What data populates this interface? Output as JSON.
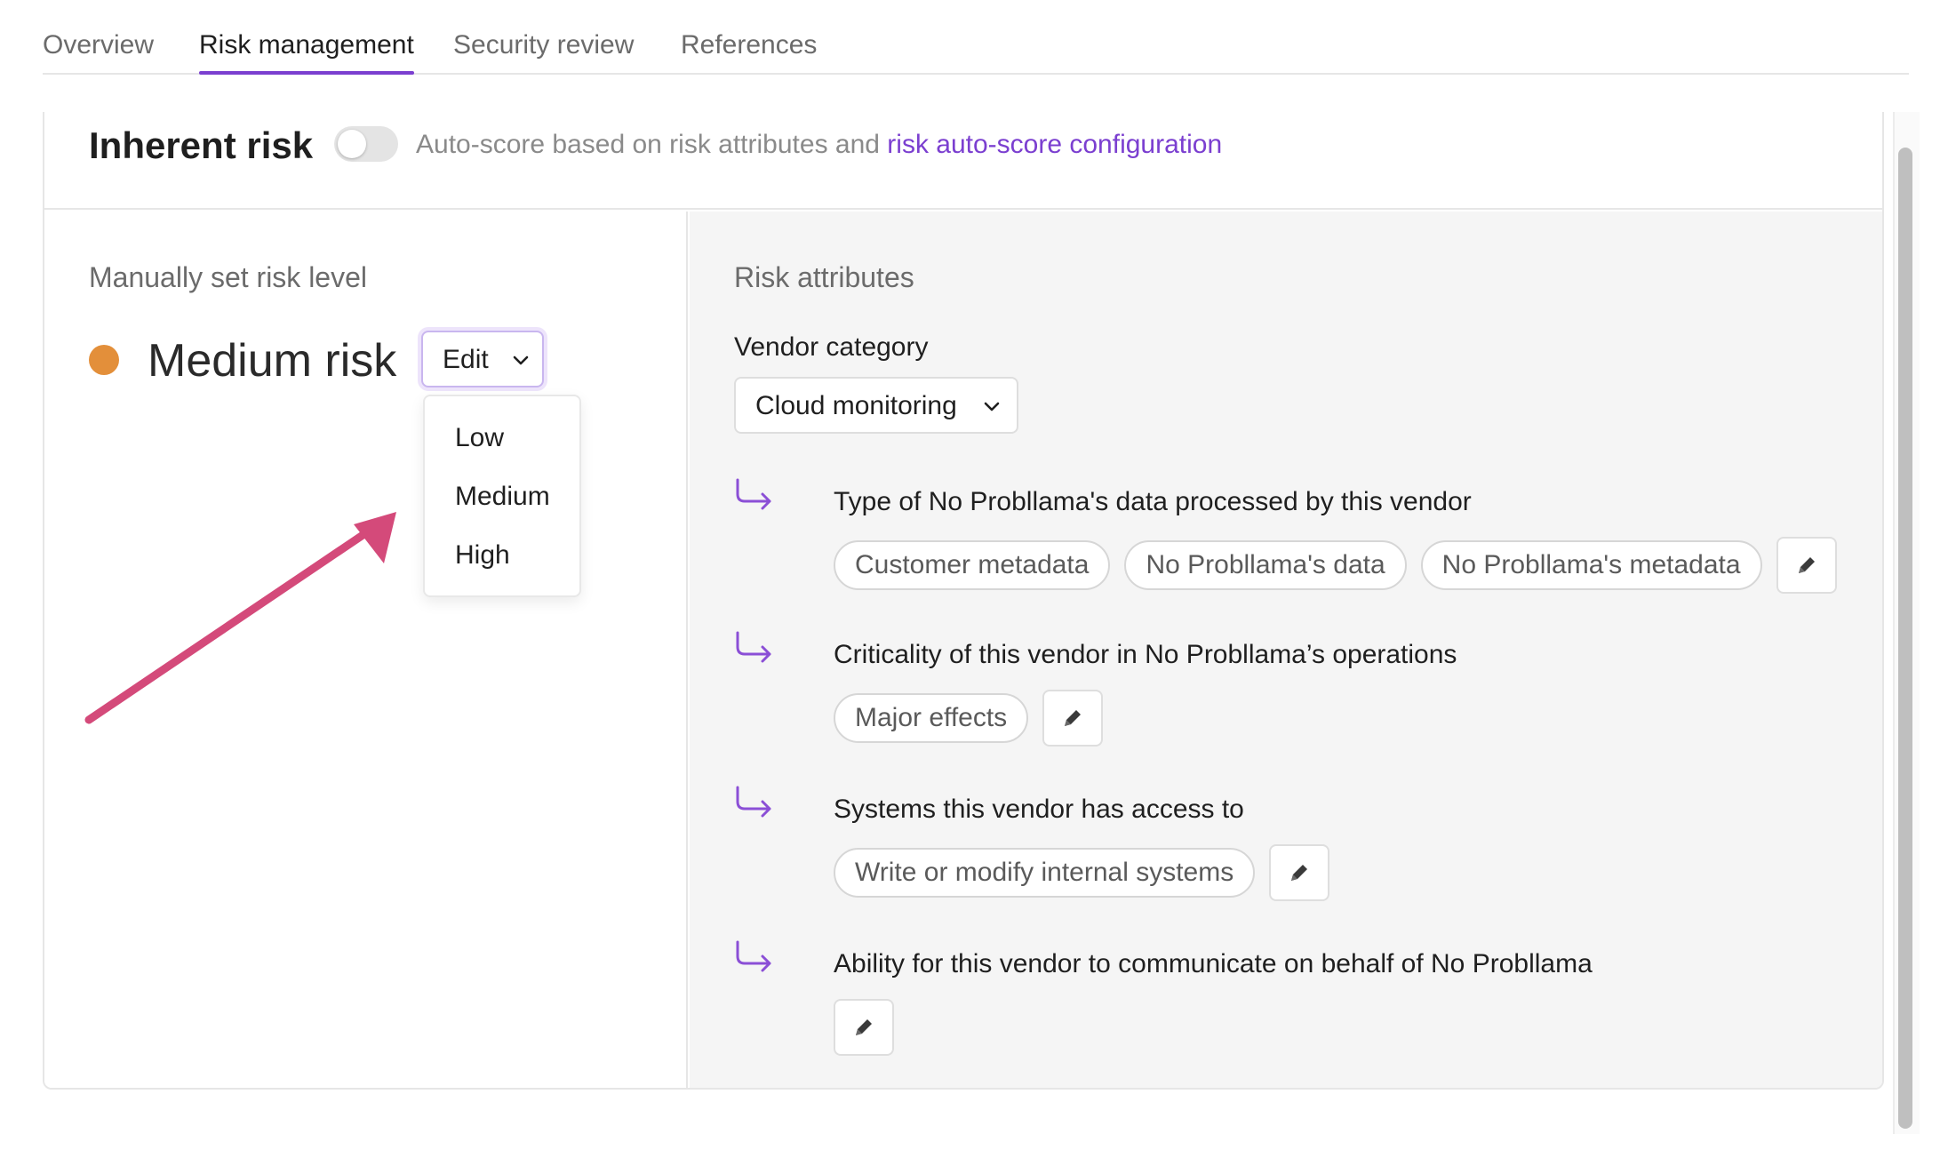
{
  "tabs": [
    {
      "label": "Overview",
      "active": false
    },
    {
      "label": "Risk management",
      "active": true
    },
    {
      "label": "Security review",
      "active": false
    },
    {
      "label": "References",
      "active": false
    }
  ],
  "inherent_risk": {
    "title": "Inherent risk",
    "toggle_on": false,
    "auto_text": "Auto-score based on risk attributes and ",
    "auto_link": "risk auto-score configuration"
  },
  "manual": {
    "label": "Manually set risk level",
    "risk_level": "Medium risk",
    "risk_color": "#e38f3a",
    "edit_label": "Edit",
    "options": [
      "Low",
      "Medium",
      "High"
    ]
  },
  "attributes": {
    "title": "Risk attributes",
    "vendor_category_label": "Vendor category",
    "vendor_category_value": "Cloud monitoring",
    "items": [
      {
        "question": "Type of No Probllama's data processed by this vendor",
        "chips": [
          "Customer metadata",
          "No Probllama's data",
          "No Probllama's metadata"
        ]
      },
      {
        "question": "Criticality of this vendor in No Probllama’s operations",
        "chips": [
          "Major effects"
        ]
      },
      {
        "question": "Systems this vendor has access to",
        "chips": [
          "Write or modify internal systems"
        ]
      },
      {
        "question": "Ability for this vendor to communicate on behalf of No Probllama",
        "chips": []
      }
    ]
  },
  "colors": {
    "accent": "#7b3fd0",
    "annotation_arrow": "#d44a7a"
  }
}
